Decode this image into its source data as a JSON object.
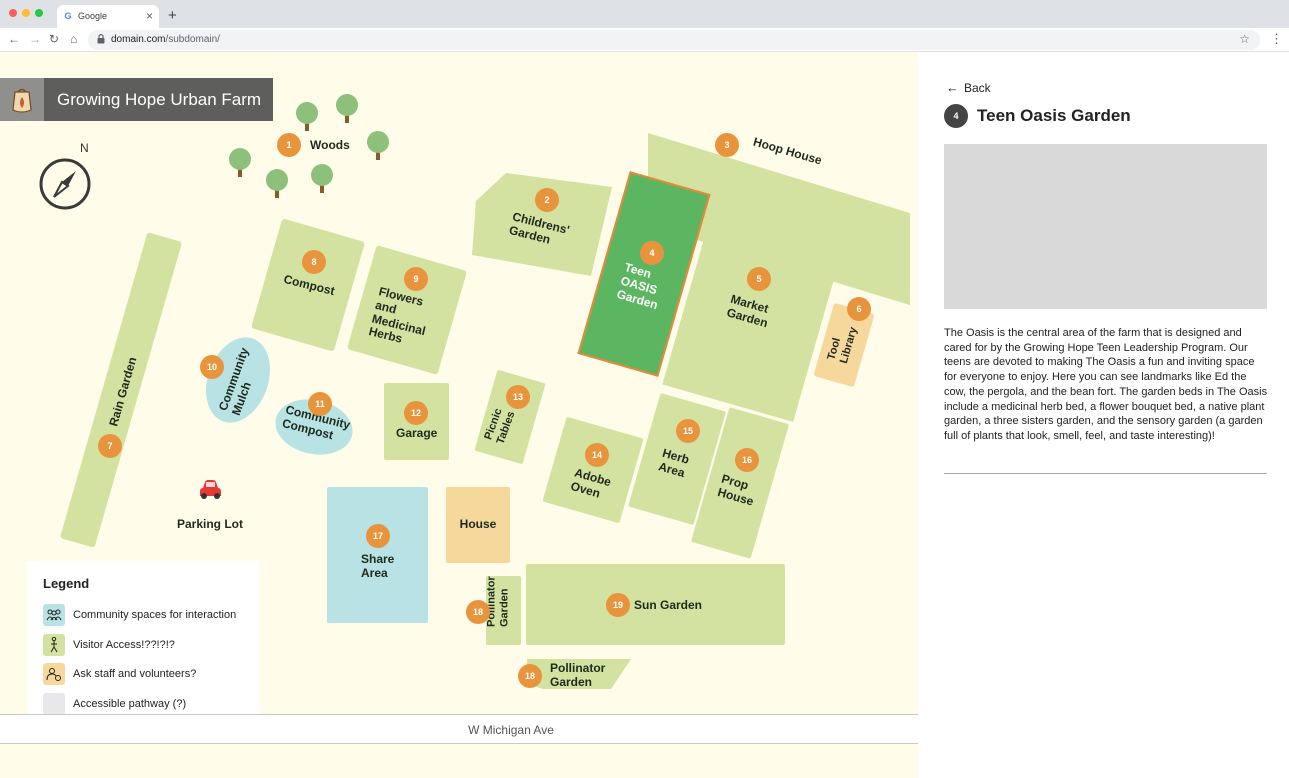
{
  "browser": {
    "tab_title": "Google",
    "new_tab": "+",
    "url_domain": "domain.com",
    "url_path": "/subdomain/"
  },
  "map": {
    "title": "Growing Hope Urban Farm",
    "compass_label": "N",
    "street": "W Michigan Ave",
    "plots": [
      {
        "num": "1",
        "label": "Woods"
      },
      {
        "num": "2",
        "label": "Childrens'\nGarden"
      },
      {
        "num": "3",
        "label": "Hoop House"
      },
      {
        "num": "4",
        "label": "Teen\nOASIS\nGarden"
      },
      {
        "num": "5",
        "label": "Market\nGarden"
      },
      {
        "num": "6",
        "label": "Tool\nLibrary"
      },
      {
        "num": "7",
        "label": "Rain Garden"
      },
      {
        "num": "8",
        "label": "Compost"
      },
      {
        "num": "9",
        "label": "Flowers\nand\nMedicinal\nHerbs"
      },
      {
        "num": "10",
        "label": "Community\nMulch"
      },
      {
        "num": "11",
        "label": "Community\nCompost"
      },
      {
        "num": "12",
        "label": "Garage"
      },
      {
        "num": "13",
        "label": "Picnic\nTables"
      },
      {
        "num": "14",
        "label": "Adobe\nOven"
      },
      {
        "num": "15",
        "label": "Herb\nArea"
      },
      {
        "num": "16",
        "label": "Prop\nHouse"
      },
      {
        "num": "17",
        "label": "Share\nArea"
      },
      {
        "num": "18",
        "label": "Pollinator\nGarden"
      },
      {
        "num": "19",
        "label": "Sun Garden"
      },
      {
        "num": "18",
        "label": "Pollinator\nGarden"
      }
    ],
    "house_label": "House",
    "parking_label": "Parking Lot",
    "legend": {
      "title": "Legend",
      "items": [
        {
          "text": "Community spaces for interaction",
          "color": "#b8e2e3",
          "icon": "people-icon"
        },
        {
          "text": "Visitor Access!??!?!?",
          "color": "#d3e2a0",
          "icon": "walking-person-icon"
        },
        {
          "text": "Ask staff and volunteers?",
          "color": "#f7d89c",
          "icon": "person-gear-icon"
        },
        {
          "text": "Accessible pathway (?)",
          "color": "#e8e8ec",
          "icon": ""
        }
      ]
    }
  },
  "panel": {
    "back_label": "Back",
    "badge_num": "4",
    "title": "Teen Oasis Garden",
    "description": "The Oasis is the central area of the farm that is designed and cared for by the Growing Hope Teen Leadership Program. Our teens are devoted to making The Oasis a fun and inviting space for everyone to enjoy. Here you can see landmarks like Ed the cow, the pergola, and the bean fort. The garden beds in The Oasis include a medicinal herb bed, a flower bouquet bed, a native plant garden, a three sisters garden, and the sensory garden (a garden full of plants that look, smell, feel, and taste interesting)!"
  },
  "colors": {
    "marker": "#e8943c",
    "plot_green": "#d3e2a0",
    "community_blue": "#b8e2e3",
    "staff_orange": "#f7d89c",
    "teen_green": "#5bb561",
    "map_background": "#fffdea"
  }
}
